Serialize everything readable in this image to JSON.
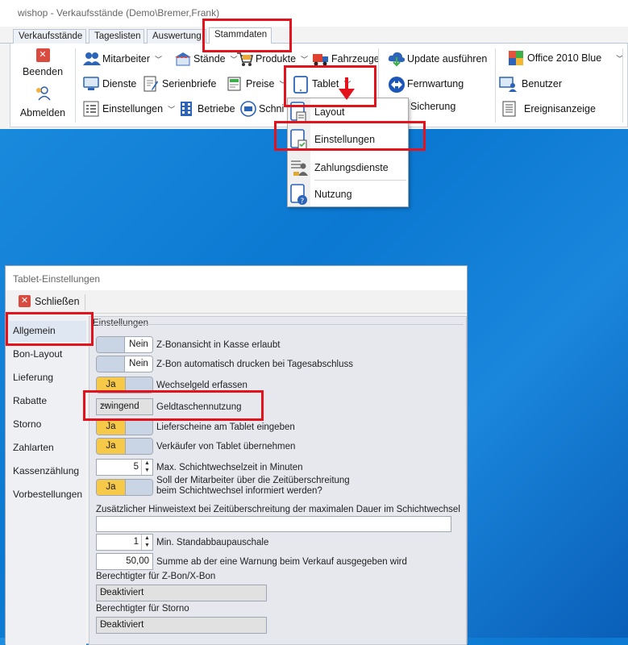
{
  "app": {
    "title": "wishop - Verkaufsstände (Demo\\Bremer,Frank)"
  },
  "tabs": [
    "Verkaufsstände",
    "Tageslisten",
    "Auswertung",
    "Stammdaten"
  ],
  "ribbon": {
    "beenden": "Beenden",
    "abmelden": "Abmelden",
    "mitarbeiter": "Mitarbeiter",
    "staende": "Stände",
    "produkte": "Produkte",
    "fahrzeuge": "Fahrzeuge",
    "dienste": "Dienste",
    "serienbriefe": "Serienbriefe",
    "preise": "Preise",
    "tablet": "Tablet",
    "einstellungen": "Einstellungen",
    "betriebe": "Betriebe",
    "schnitt": "Schni",
    "update": "Update ausführen",
    "fernwartung": "Fernwartung",
    "sicherung": "Sicherung",
    "theme": "Office 2010 Blue",
    "benutzer": "Benutzer",
    "ereignisanzeige": "Ereignisanzeige"
  },
  "tablet_menu": [
    "Layout",
    "Einstellungen",
    "Zahlungsdienste",
    "Nutzung"
  ],
  "dialog": {
    "title": "Tablet-Einstellungen",
    "close": "Schließen",
    "nav": [
      "Allgemein",
      "Bon-Layout",
      "Lieferung",
      "Rabatte",
      "Storno",
      "Zahlarten",
      "Kassenzählung",
      "Vorbestellungen"
    ],
    "group": "Einstellungen",
    "toggle_ja": "Ja",
    "toggle_nein": "Nein",
    "settings": {
      "zbon_ansicht": "Z-Bonansicht in Kasse erlaubt",
      "zbon_druck": "Z-Bon automatisch drucken bei Tagesabschluss",
      "wechselgeld": "Wechselgeld erfassen",
      "geldtasche_value": "zwingend",
      "geldtasche": "Geldtaschennutzung",
      "lieferscheine": "Lieferscheine am Tablet eingeben",
      "verkaeufer": "Verkäufer von Tablet übernehmen",
      "schicht_value": "5",
      "schicht": "Max. Schichtwechselzeit in Minuten",
      "mitarbeiter_info_1": "Soll der Mitarbeiter über die Zeitüberschreitung",
      "mitarbeiter_info_2": "beim Schichtwechsel informiert werden?",
      "hinweistext": "Zusätzlicher Hinweistext bei Zeitüberschreitung der maximalen Dauer im Schichtwechsel",
      "standabbau_value": "1",
      "standabbau": "Min. Standabbaupauschale",
      "warnung_value": "50,00",
      "warnung": "Summe ab der eine Warnung beim Verkauf ausgegeben wird",
      "zbon_berechtigt": "Berechtigter für Z-Bon/X-Bon",
      "zbon_berechtigt_value": "Deaktiviert",
      "storno_berechtigt": "Berechtigter für Storno",
      "storno_berechtigt_value": "Deaktiviert"
    }
  },
  "colors": {
    "highlight": "#e2131c",
    "toggle_on": "#f7c948",
    "toggle_off": "#c9d4e4"
  }
}
